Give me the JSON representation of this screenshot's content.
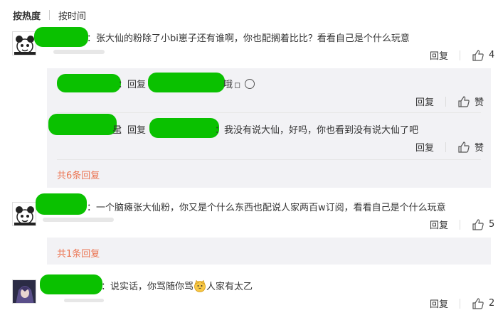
{
  "sort": {
    "hot": "按热度",
    "time": "按时间"
  },
  "colors": {
    "accent": "#eb7350",
    "redaction": "#0ac100",
    "reply_bg": "#f2f2f5"
  },
  "comments": [
    {
      "text": "：张大仙的粉除了小bi崽子还有谁啊，你也配搁着比比？看看自己是个什么玩意",
      "reply_label": "回复",
      "likes": "4"
    },
    {
      "text": "：一个脑瘫张大仙粉，你又是个什么东西也配说人家两百w订阅，看看自己是个什么玩意",
      "reply_label": "回复",
      "likes": "5"
    },
    {
      "text_before": "：说实话，你骂随你骂",
      "text_after": "人家有太乙",
      "reply_label": "回复",
      "likes": "2"
    }
  ],
  "sub_replies": [
    {
      "prefix": "：回复",
      "suffix": "哦",
      "emoji_box": "◻",
      "reply_label": "回复",
      "like_label": "赞"
    },
    {
      "partial_name": "星",
      "prefix": "：回复",
      "suffix": "：我没有说大仙，好吗，你也看到没有说大仙了吧",
      "reply_label": "回复",
      "like_label": "赞"
    }
  ],
  "more": [
    {
      "label": "共6条回复"
    },
    {
      "label": "共1条回复"
    }
  ]
}
